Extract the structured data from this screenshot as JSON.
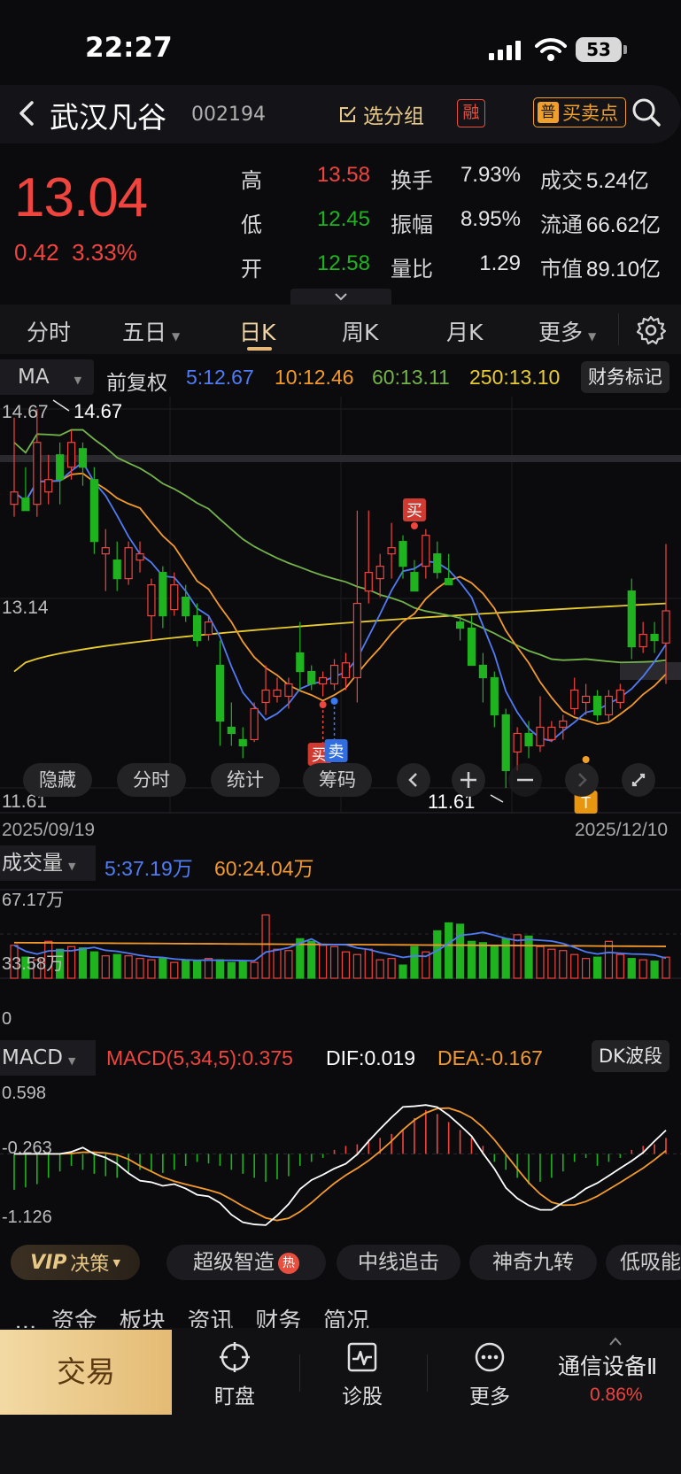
{
  "status": {
    "time": "22:27",
    "battery": "53"
  },
  "header": {
    "stock_name": "武汉凡谷",
    "stock_code": "002194",
    "watch_group": "选分组",
    "margin_badge": "融",
    "buysell_badge": "普",
    "buysell_label": "买卖点"
  },
  "quote": {
    "price": "13.04",
    "change": "0.42",
    "change_pct": "3.33%",
    "high_label": "高",
    "high": "13.58",
    "low_label": "低",
    "low": "12.45",
    "open_label": "开",
    "open": "12.58",
    "turnover_label": "换手",
    "turnover": "7.93%",
    "amplitude_label": "振幅",
    "amplitude": "8.95%",
    "volratio_label": "量比",
    "volratio": "1.29",
    "amount_label": "成交",
    "amount": "5.24亿",
    "float_label": "流通",
    "float": "66.62亿",
    "mcap_label": "市值",
    "mcap": "89.10亿"
  },
  "tabs": [
    "分时",
    "五日",
    "日K",
    "周K",
    "月K",
    "更多"
  ],
  "ma_bar": {
    "selector": "MA",
    "adjust": "前复权",
    "ma5": "5:12.67",
    "ma10": "10:12.46",
    "ma60": "60:13.11",
    "ma250": "250:13.10",
    "finance_mark": "财务标记"
  },
  "kline": {
    "y_top": "14.67",
    "y_mid": "13.14",
    "y_bottom": "11.61",
    "high_note": "14.67",
    "low_note": "11.61",
    "date_start": "2025/09/19",
    "date_end": "2025/12/10",
    "signal_buy": "买",
    "signal_sell": "卖",
    "signal_t": "T"
  },
  "chart_tools": [
    "隐藏",
    "分时",
    "统计",
    "筹码"
  ],
  "volume": {
    "label": "成交量",
    "ma5": "5:37.19万",
    "ma60": "60:24.04万",
    "y_top": "67.17万",
    "y_mid": "33.58万",
    "y_bottom": "0"
  },
  "macd": {
    "label": "MACD",
    "value": "MACD(5,34,5):0.375",
    "dif": "DIF:0.019",
    "dea": "DEA:-0.167",
    "y_top": "0.598",
    "y_mid": "-0.263",
    "y_bottom": "-1.126",
    "badge": "DK波段"
  },
  "strategies": {
    "vip": "决策",
    "vip_prefix": "VIP",
    "items": [
      "超级智造",
      "中线追击",
      "神奇九转",
      "低吸能"
    ],
    "hot": "热"
  },
  "info_tabs_ghost": "  ...  资金   板块   资讯   财务   简况",
  "bottom_nav": {
    "trade": "交易",
    "items": [
      "盯盘",
      "诊股",
      "更多"
    ],
    "sector_name": "通信设备Ⅱ",
    "sector_change": "0.86%"
  },
  "colors": {
    "up": "#f0443e",
    "down": "#1fb31f",
    "ma5": "#4f7cf5",
    "ma10": "#f39a2b",
    "ma60": "#73b34a",
    "ma250": "#e8cc2e",
    "accent": "#e8c887"
  },
  "chart_data": [
    {
      "type": "candlestick",
      "title": "",
      "x": [
        "2025/09/19",
        "2025/12/10"
      ],
      "y_ticks": [
        14.67,
        13.14,
        11.61
      ],
      "ylim": [
        11.61,
        14.67
      ],
      "series": [
        {
          "name": "5",
          "last": 12.67
        },
        {
          "name": "10",
          "last": 12.46
        },
        {
          "name": "60",
          "last": 13.11
        },
        {
          "name": "250",
          "last": 13.1
        }
      ],
      "candles": [
        {
          "o": 13.9,
          "h": 14.6,
          "l": 13.8,
          "c": 14.0
        },
        {
          "o": 13.95,
          "h": 14.2,
          "l": 13.85,
          "c": 13.85
        },
        {
          "o": 13.9,
          "h": 14.67,
          "l": 13.8,
          "c": 14.4
        },
        {
          "o": 14.0,
          "h": 14.3,
          "l": 13.9,
          "c": 14.1
        },
        {
          "o": 14.3,
          "h": 14.4,
          "l": 13.9,
          "c": 14.1
        },
        {
          "o": 14.2,
          "h": 14.5,
          "l": 14.1,
          "c": 14.4
        },
        {
          "o": 14.35,
          "h": 14.4,
          "l": 14.05,
          "c": 14.2
        },
        {
          "o": 14.1,
          "h": 14.2,
          "l": 13.5,
          "c": 13.6
        },
        {
          "o": 13.5,
          "h": 13.7,
          "l": 13.2,
          "c": 13.55
        },
        {
          "o": 13.45,
          "h": 13.6,
          "l": 13.2,
          "c": 13.3
        },
        {
          "o": 13.3,
          "h": 13.6,
          "l": 13.25,
          "c": 13.55
        },
        {
          "o": 13.45,
          "h": 13.6,
          "l": 13.35,
          "c": 13.5
        },
        {
          "o": 13.0,
          "h": 13.3,
          "l": 12.8,
          "c": 13.25
        },
        {
          "o": 13.35,
          "h": 13.4,
          "l": 12.9,
          "c": 13.0
        },
        {
          "o": 13.05,
          "h": 13.35,
          "l": 13.0,
          "c": 13.25
        },
        {
          "o": 13.15,
          "h": 13.25,
          "l": 12.95,
          "c": 13.0
        },
        {
          "o": 13.0,
          "h": 13.1,
          "l": 12.75,
          "c": 12.8
        },
        {
          "o": 12.85,
          "h": 13.0,
          "l": 12.8,
          "c": 12.95
        },
        {
          "o": 12.6,
          "h": 12.8,
          "l": 11.95,
          "c": 12.15
        },
        {
          "o": 12.1,
          "h": 12.3,
          "l": 11.95,
          "c": 12.05
        },
        {
          "o": 12.0,
          "h": 12.1,
          "l": 11.85,
          "c": 11.95
        },
        {
          "o": 12.0,
          "h": 12.3,
          "l": 11.98,
          "c": 12.25
        },
        {
          "o": 12.3,
          "h": 12.6,
          "l": 12.2,
          "c": 12.4
        },
        {
          "o": 12.35,
          "h": 12.5,
          "l": 12.3,
          "c": 12.4
        },
        {
          "o": 12.35,
          "h": 12.5,
          "l": 12.25,
          "c": 12.45
        },
        {
          "o": 12.7,
          "h": 12.95,
          "l": 12.4,
          "c": 12.55
        },
        {
          "o": 12.55,
          "h": 12.6,
          "l": 12.4,
          "c": 12.45
        },
        {
          "o": 12.45,
          "h": 12.55,
          "l": 12.35,
          "c": 12.5
        },
        {
          "o": 12.45,
          "h": 12.65,
          "l": 12.4,
          "c": 12.6
        },
        {
          "o": 12.5,
          "h": 12.7,
          "l": 12.4,
          "c": 12.62
        },
        {
          "o": 12.5,
          "h": 13.85,
          "l": 12.3,
          "c": 13.1
        },
        {
          "o": 13.2,
          "h": 13.85,
          "l": 13.1,
          "c": 13.35
        },
        {
          "o": 13.3,
          "h": 13.5,
          "l": 13.15,
          "c": 13.4
        },
        {
          "o": 13.5,
          "h": 13.75,
          "l": 13.3,
          "c": 13.55
        },
        {
          "o": 13.6,
          "h": 13.65,
          "l": 13.3,
          "c": 13.4
        },
        {
          "o": 13.35,
          "h": 13.45,
          "l": 13.2,
          "c": 13.2
        },
        {
          "o": 13.4,
          "h": 13.7,
          "l": 13.3,
          "c": 13.65
        },
        {
          "o": 13.5,
          "h": 13.6,
          "l": 13.3,
          "c": 13.35
        },
        {
          "o": 13.3,
          "h": 13.5,
          "l": 13.25,
          "c": 13.25
        },
        {
          "o": 12.95,
          "h": 13.0,
          "l": 12.8,
          "c": 12.9
        },
        {
          "o": 12.9,
          "h": 13.0,
          "l": 12.6,
          "c": 12.6
        },
        {
          "o": 12.6,
          "h": 12.7,
          "l": 12.3,
          "c": 12.5
        },
        {
          "o": 12.5,
          "h": 12.55,
          "l": 12.1,
          "c": 12.2
        },
        {
          "o": 12.2,
          "h": 12.25,
          "l": 11.61,
          "c": 11.75
        },
        {
          "o": 11.9,
          "h": 12.1,
          "l": 11.75,
          "c": 12.05
        },
        {
          "o": 12.05,
          "h": 12.15,
          "l": 11.85,
          "c": 11.95
        },
        {
          "o": 11.95,
          "h": 12.35,
          "l": 11.9,
          "c": 12.1
        },
        {
          "o": 12.0,
          "h": 12.15,
          "l": 11.98,
          "c": 12.1
        },
        {
          "o": 12.1,
          "h": 12.2,
          "l": 12.0,
          "c": 12.15
        },
        {
          "o": 12.25,
          "h": 12.5,
          "l": 12.2,
          "c": 12.4
        },
        {
          "o": 12.3,
          "h": 12.45,
          "l": 12.2,
          "c": 12.35
        },
        {
          "o": 12.35,
          "h": 12.4,
          "l": 12.15,
          "c": 12.2
        },
        {
          "o": 12.2,
          "h": 12.4,
          "l": 12.15,
          "c": 12.35
        },
        {
          "o": 12.3,
          "h": 12.45,
          "l": 12.25,
          "c": 12.4
        },
        {
          "o": 13.2,
          "h": 13.3,
          "l": 12.65,
          "c": 12.75
        },
        {
          "o": 12.75,
          "h": 12.95,
          "l": 12.7,
          "c": 12.85
        },
        {
          "o": 12.85,
          "h": 12.95,
          "l": 12.7,
          "c": 12.8
        },
        {
          "o": 12.78,
          "h": 13.58,
          "l": 12.45,
          "c": 13.04
        }
      ],
      "signals": [
        {
          "type": "buy",
          "label": "买"
        },
        {
          "type": "buy",
          "label": "买"
        },
        {
          "type": "sell",
          "label": "卖"
        },
        {
          "type": "sell",
          "label": "卖"
        },
        {
          "type": "t",
          "label": "T"
        },
        {
          "type": "t",
          "label": "T"
        }
      ]
    },
    {
      "type": "bar",
      "title": "成交量",
      "ylim": [
        0,
        67.17
      ],
      "y_ticks": [
        "67.17万",
        "33.58万",
        "0"
      ],
      "series": [
        {
          "name": "5",
          "last": 37.19
        },
        {
          "name": "60",
          "last": 24.04
        }
      ],
      "values": [
        25,
        16,
        14,
        28,
        22,
        24,
        23,
        20,
        17,
        18,
        17,
        15,
        14,
        15,
        12,
        14,
        13,
        15,
        14,
        12,
        13,
        12,
        48,
        22,
        21,
        30,
        28,
        25,
        24,
        20,
        18,
        22,
        14,
        15,
        10,
        24,
        20,
        36,
        42,
        41,
        28,
        27,
        25,
        30,
        33,
        32,
        24,
        22,
        21,
        18,
        15,
        16,
        28,
        18,
        15,
        14,
        13,
        16,
        14,
        12,
        13,
        40,
        22,
        58,
        30
      ]
    },
    {
      "type": "bar",
      "title": "MACD",
      "ylim": [
        -1.126,
        0.598
      ],
      "y_ticks": [
        0.598,
        -0.263,
        -1.126
      ],
      "series": [
        {
          "name": "MACD(5,34,5)",
          "last": 0.375
        },
        {
          "name": "DIF",
          "last": 0.019
        },
        {
          "name": "DEA",
          "last": -0.167
        }
      ],
      "values": [
        -0.45,
        -0.42,
        -0.38,
        -0.3,
        -0.22,
        -0.15,
        -0.2,
        -0.25,
        -0.28,
        -0.3,
        -0.25,
        -0.2,
        -0.22,
        -0.24,
        -0.2,
        -0.15,
        -0.1,
        -0.12,
        -0.15,
        -0.2,
        -0.25,
        -0.3,
        -0.35,
        -0.32,
        -0.28,
        -0.15,
        -0.1,
        -0.05,
        0.05,
        0.1,
        0.12,
        0.18,
        0.2,
        0.25,
        0.3,
        0.45,
        0.55,
        0.5,
        0.4,
        0.3,
        0.2,
        0.1,
        -0.1,
        -0.2,
        -0.3,
        -0.38,
        -0.35,
        -0.3,
        -0.22,
        -0.1,
        -0.05,
        -0.15,
        -0.1,
        -0.05,
        0.05,
        0.1,
        0.12,
        0.2,
        0.25,
        0.3,
        0.35,
        0.38,
        0.4,
        0.375
      ]
    }
  ]
}
